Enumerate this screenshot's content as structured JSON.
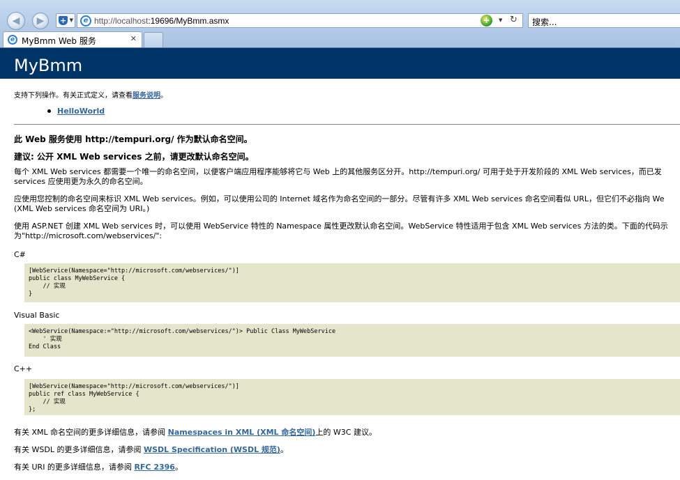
{
  "browser": {
    "address_url_prefix": "http://localhost",
    "address_url_rest": ":19696/MyBmm.asmx",
    "search_placeholder": "搜索...",
    "tab_title": "MyBmm Web 服务",
    "tab_close": "✕",
    "back_glyph": "◀",
    "forward_glyph": "▶",
    "refresh_glyph": "↻",
    "dropdown_glyph": "▼",
    "favorites_glyph": "+",
    "compat_glyph": "+",
    "page_icon_glyph": "e"
  },
  "page": {
    "heading": "MyBmm",
    "intro_text": "支持下列操作。有关正式定义，请查看",
    "intro_link": "服务说明",
    "intro_end": "。",
    "operations": [
      "HelloWorld"
    ],
    "namespace_heading": "此 Web 服务使用 http://tempuri.org/ 作为默认命名空间。",
    "recommend_heading": "建议: 公开 XML Web services 之前，请更改默认命名空间。",
    "para1_line1": "每个 XML Web services 都需要一个唯一的命名空间，以便客户端应用程序能够将它与 Web 上的其他服务区分开。http://tempuri.org/ 可用于处于开发阶段的 XML Web services，而已发",
    "para1_line2": "services 应使用更为永久的命名空间。",
    "para2_line1": "应使用您控制的命名空间来标识 XML Web services。例如，可以使用公司的 Internet 域名作为命名空间的一部分。尽管有许多 XML Web services 命名空间看似 URL，但它们不必指向 We",
    "para2_line2": "(XML Web services 命名空间为 URI。)",
    "para3_line1": "使用 ASP.NET 创建 XML Web services 时，可以使用 WebService 特性的 Namespace 属性更改默认命名空间。WebService 特性适用于包含 XML Web services 方法的类。下面的代码示",
    "para3_line2": "为\"http://microsoft.com/webservices/\":",
    "code_samples": [
      {
        "lang": "C#",
        "code": "[WebService(Namespace=\"http://microsoft.com/webservices/\")]\npublic class MyWebService {\n    // 实现\n}"
      },
      {
        "lang": "Visual Basic",
        "code": "<WebService(Namespace:=\"http://microsoft.com/webservices/\")> Public Class MyWebService\n    ' 实现\nEnd Class"
      },
      {
        "lang": "C++",
        "code": "[WebService(Namespace=\"http://microsoft.com/webservices/\")]\npublic ref class MyWebService {\n    // 实现\n};"
      }
    ],
    "footer1_text": "有关 XML 命名空间的更多详细信息，请参阅 ",
    "footer1_link": "Namespaces in XML (XML 命名空间)",
    "footer1_end": "上的 W3C 建议。",
    "footer2_text": "有关 WSDL 的更多详细信息，请参阅 ",
    "footer2_link": "WSDL Specification (WSDL 规范)",
    "footer2_end": "。",
    "footer3_text": "有关 URI 的更多详细信息，请参阅 ",
    "footer3_link": "RFC 2396",
    "footer3_end": "。"
  },
  "colors": {
    "heading_bg": "#003366",
    "link": "#336699",
    "code_bg": "#e5e5cc"
  }
}
